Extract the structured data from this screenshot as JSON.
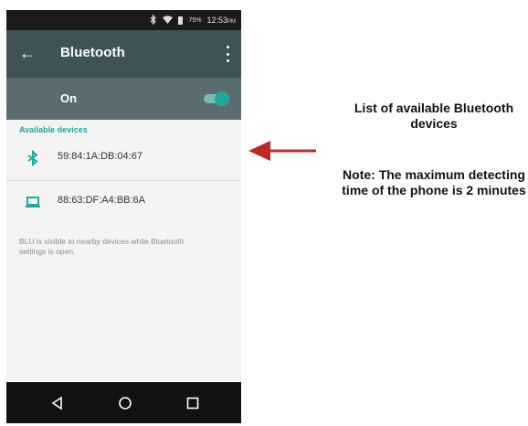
{
  "status_bar": {
    "battery_percent": "75%",
    "time": "12:53",
    "am_pm": "PM"
  },
  "app_bar": {
    "title": "Bluetooth"
  },
  "toggle": {
    "label": "On",
    "state": "on"
  },
  "available_devices": {
    "header": "Available devices",
    "items": [
      {
        "name": "59:84:1A:DB:04:67",
        "icon": "bluetooth-icon"
      },
      {
        "name": "88:63:DF:A4:BB:6A",
        "icon": "laptop-icon"
      }
    ]
  },
  "visibility_note": "BLU is visible to nearby devices while Bluetooth settings is open.",
  "annotation": {
    "title": "List of available Bluetooth devices",
    "note": "Note: The maximum detecting time of the phone is 2 minutes"
  },
  "colors": {
    "app_bar": "#3f5257",
    "toggle_bar": "#5b6c70",
    "accent": "#20a89c",
    "arrow": "#c0282a"
  }
}
